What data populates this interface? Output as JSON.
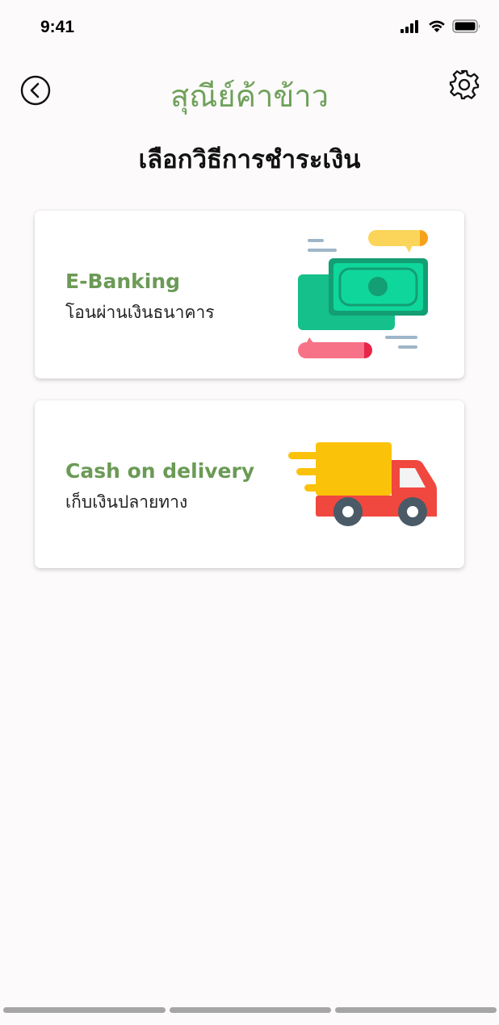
{
  "status_bar": {
    "time": "9:41",
    "icons": [
      "signal-icon",
      "wifi-icon",
      "battery-icon"
    ]
  },
  "header": {
    "back_icon": "back-arrow-icon",
    "app_title": "สุณีย์ค้าข้าว",
    "settings_icon": "gear-icon"
  },
  "page_title": "เลือกวิธีการชำระเงิน",
  "payment_options": [
    {
      "title": "E-Banking",
      "subtitle": "โอนผ่านเงินธนาคาร",
      "icon": "money-transfer-icon"
    },
    {
      "title": "Cash on delivery",
      "subtitle": "เก็บเงินปลายทาง",
      "icon": "delivery-truck-icon"
    }
  ],
  "colors": {
    "accent": "#6b9a56",
    "background": "#fcfafb",
    "card": "#ffffff",
    "money_green": "#16c08a",
    "truck_red": "#f0483e",
    "truck_yellow": "#fbc20a"
  }
}
